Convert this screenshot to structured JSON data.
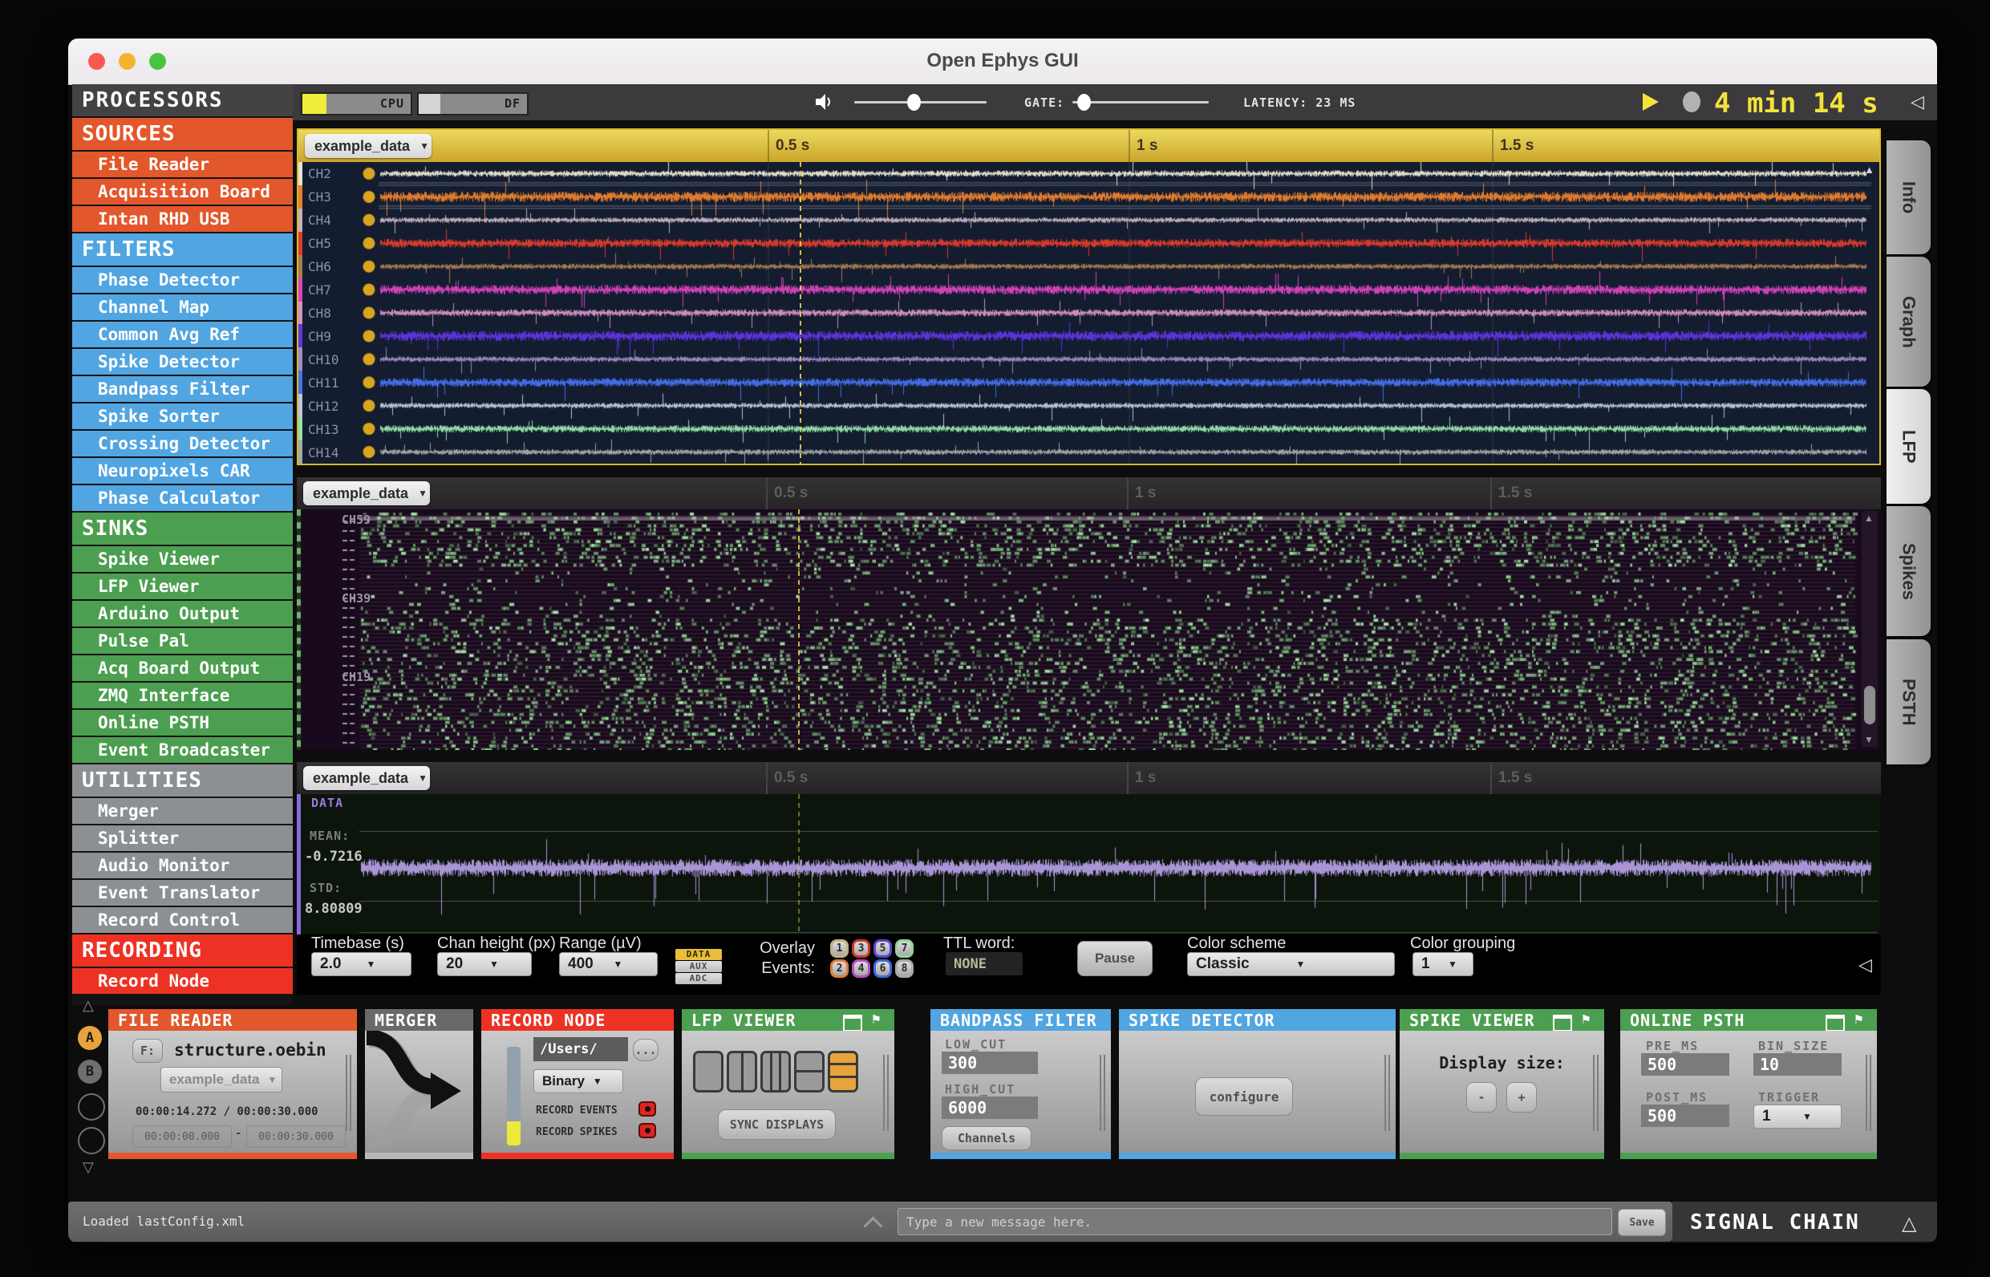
{
  "window": {
    "title": "Open Ephys GUI"
  },
  "toolbar": {
    "cpu_label": "CPU",
    "cpu_fill": 0.22,
    "df_label": "DF",
    "df_fill": 0.2,
    "volume_value": 0.45,
    "gate_label": "GATE:",
    "gate_value": 0.08,
    "latency": "LATENCY: 23 MS",
    "timer": "4 min 14 s"
  },
  "sidebar": {
    "title": "PROCESSORS",
    "sections": [
      {
        "name": "SOURCES",
        "color": "#e2572b",
        "items": [
          "File Reader",
          "Acquisition Board",
          "Intan RHD USB"
        ]
      },
      {
        "name": "FILTERS",
        "color": "#51a5e1",
        "items": [
          "Phase Detector",
          "Channel Map",
          "Common Avg Ref",
          "Spike Detector",
          "Bandpass Filter",
          "Spike Sorter",
          "Crossing Detector",
          "Neuropixels CAR",
          "Phase Calculator"
        ]
      },
      {
        "name": "SINKS",
        "color": "#4c9f50",
        "items": [
          "Spike Viewer",
          "LFP Viewer",
          "Arduino Output",
          "Pulse Pal",
          "Acq Board Output",
          "ZMQ Interface",
          "Online PSTH",
          "Event Broadcaster"
        ]
      },
      {
        "name": "UTILITIES",
        "color": "#8d9093",
        "items": [
          "Merger",
          "Splitter",
          "Audio Monitor",
          "Event Translator",
          "Record Control"
        ]
      },
      {
        "name": "RECORDING",
        "color": "#ed3224",
        "items": [
          "Record Node"
        ]
      }
    ]
  },
  "tabs": [
    {
      "label": "Info",
      "active": false
    },
    {
      "label": "Graph",
      "active": false
    },
    {
      "label": "LFP",
      "active": true
    },
    {
      "label": "Spikes",
      "active": false
    },
    {
      "label": "PSTH",
      "active": false
    }
  ],
  "viewers": {
    "selector_label": "example_data",
    "time_ticks": [
      "0.5 s",
      "1 s",
      "1.5 s"
    ],
    "playhead_color": "#e8d44a",
    "lfp": {
      "channels": [
        {
          "name": "CH2",
          "color": "#e9e5cf"
        },
        {
          "name": "CH3",
          "color": "#e87f2e"
        },
        {
          "name": "CH4",
          "color": "#c4b2bf"
        },
        {
          "name": "CH5",
          "color": "#df3c2b"
        },
        {
          "name": "CH6",
          "color": "#a97c4e"
        },
        {
          "name": "CH7",
          "color": "#d644bd"
        },
        {
          "name": "CH8",
          "color": "#d392c4"
        },
        {
          "name": "CH9",
          "color": "#5f35e3"
        },
        {
          "name": "CH10",
          "color": "#9e8cc2"
        },
        {
          "name": "CH11",
          "color": "#4472eb"
        },
        {
          "name": "CH12",
          "color": "#bcc6da"
        },
        {
          "name": "CH13",
          "color": "#93e3a9"
        },
        {
          "name": "CH14",
          "color": "#a3abac"
        }
      ]
    },
    "raster": {
      "labels": [
        "CH59",
        "CH39",
        "CH19"
      ],
      "palette": [
        "#5d935d",
        "#74b874",
        "#8fd88f",
        "#a9e8a9"
      ]
    },
    "single": {
      "title": "DATA",
      "mean_label": "MEAN:",
      "mean": "-0.7216",
      "std_label": "STD:",
      "std": "8.80809",
      "color": "#b7a0e8"
    }
  },
  "controls": {
    "timebase_label": "Timebase (s)",
    "timebase": "2.0",
    "chan_height_label": "Chan height (px)",
    "chan_height": "20",
    "range_label": "Range (µV)",
    "range": "400",
    "subtabs": [
      "DATA",
      "AUX",
      "ADC"
    ],
    "overlay_label1": "Overlay",
    "overlay_label2": "Events:",
    "events": [
      {
        "n": "1",
        "color": "#c2b280"
      },
      {
        "n": "2",
        "color": "#e07b39"
      },
      {
        "n": "3",
        "color": "#d0342c"
      },
      {
        "n": "4",
        "color": "#b84fc0"
      },
      {
        "n": "5",
        "color": "#5b43d8"
      },
      {
        "n": "6",
        "color": "#3f69e0"
      },
      {
        "n": "7",
        "color": "#8fd694"
      },
      {
        "n": "8",
        "color": "#a9a9a9"
      }
    ],
    "ttl_label": "TTL word:",
    "ttl_value": "NONE",
    "pause_label": "Pause",
    "color_scheme_label": "Color scheme",
    "color_scheme": "Classic",
    "color_grouping_label": "Color grouping",
    "color_grouping": "1"
  },
  "chain": {
    "selector_a": "A",
    "selector_b": "B",
    "file_reader": {
      "title": "FILE READER",
      "color": "#e2572b",
      "f_label": "F:",
      "file": "structure.oebin",
      "selector": "example_data",
      "time": "00:00:14.272 / 00:00:30.000",
      "start": "00:00:00.000",
      "dash": "-",
      "end": "00:00:30.000"
    },
    "merger": {
      "title": "MERGER",
      "color": "#6a686a"
    },
    "record_node": {
      "title": "RECORD NODE",
      "color": "#ed3224",
      "path": "/Users/",
      "dots": "...",
      "engine": "Binary",
      "record_events": "RECORD EVENTS",
      "record_spikes": "RECORD SPIKES"
    },
    "lfp_viewer": {
      "title": "LFP VIEWER",
      "color": "#4c9f50",
      "sync": "SYNC DISPLAYS"
    },
    "bandpass": {
      "title": "BANDPASS FILTER",
      "color": "#51a5e1",
      "low_label": "LOW_CUT",
      "low": "300",
      "high_label": "HIGH_CUT",
      "high": "6000",
      "channels_label": "Channels"
    },
    "spike_detector": {
      "title": "SPIKE DETECTOR",
      "color": "#51a5e1",
      "configure": "configure"
    },
    "spike_viewer": {
      "title": "SPIKE VIEWER",
      "color": "#4c9f50",
      "display_label": "Display size:",
      "minus": "-",
      "plus": "+"
    },
    "online_psth": {
      "title": "ONLINE PSTH",
      "color": "#4c9f50",
      "pre_label": "PRE_MS",
      "pre": "500",
      "bin_label": "BIN_SIZE",
      "bin": "10",
      "post_label": "POST_MS",
      "post": "500",
      "trigger_label": "TRIGGER",
      "trigger": "1"
    }
  },
  "statusbar": {
    "message": "Loaded lastConfig.xml",
    "placeholder": "Type a new message here.",
    "save_label": "Save",
    "title": "SIGNAL CHAIN"
  }
}
